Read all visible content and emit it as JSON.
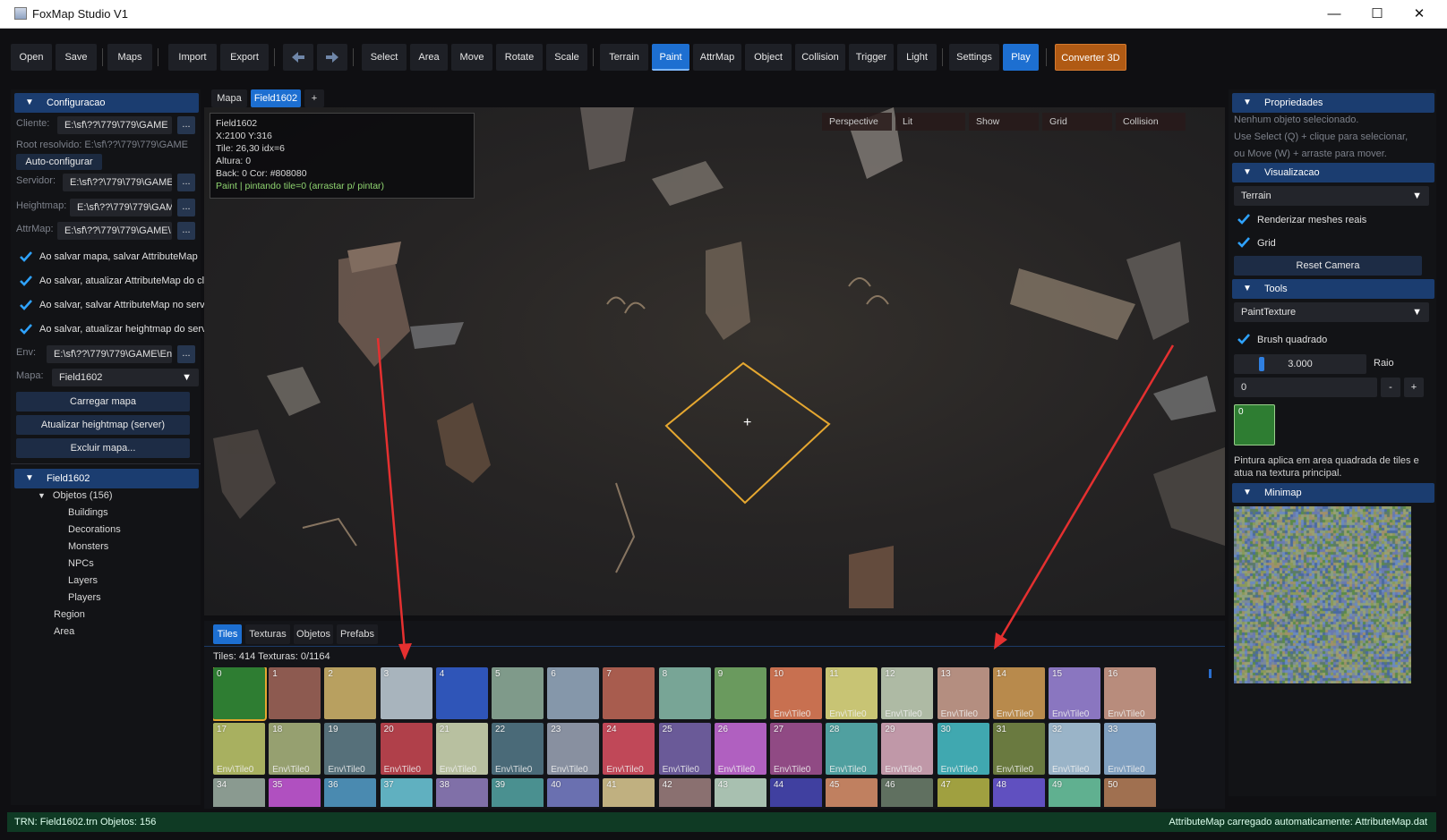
{
  "window": {
    "title": "FoxMap Studio V1",
    "minimize": "—",
    "maximize": "☐",
    "close": "✕"
  },
  "toolbar": {
    "open": "Open",
    "save": "Save",
    "maps": "Maps",
    "import": "Import",
    "export": "Export",
    "back_icon": "arrow-left-icon",
    "forward_icon": "arrow-right-icon",
    "select": "Select",
    "area": "Area",
    "move": "Move",
    "rotate": "Rotate",
    "scale": "Scale",
    "terrain": "Terrain",
    "paint": "Paint",
    "attrmap": "AttrMap",
    "object": "Object",
    "collision": "Collision",
    "trigger": "Trigger",
    "light": "Light",
    "settings": "Settings",
    "play": "Play",
    "converter": "Converter 3D",
    "active_tool": "Paint"
  },
  "config": {
    "header": "Configuracao",
    "cliente_label": "Cliente:",
    "cliente_value": "E:\\sf\\??\\779\\779\\GAME",
    "root_text": "Root resolvido: E:\\sf\\??\\779\\779\\GAME",
    "autoconfig": "Auto-configurar",
    "servidor_label": "Servidor:",
    "servidor_value": "E:\\sf\\??\\779\\779\\GAME",
    "heightmap_label": "Heightmap:",
    "heightmap_value": "E:\\sf\\??\\779\\779\\GAM",
    "attrmap_label": "AttrMap:",
    "attrmap_value": "E:\\sf\\??\\779\\779\\GAME\\",
    "check1": "Ao salvar mapa, salvar AttributeMap",
    "check2": "Ao salvar, atualizar AttributeMap do cl",
    "check3": "Ao salvar, salvar AttributeMap no servi",
    "check4": "Ao salvar, atualizar heightmap do servi",
    "env_label": "Env:",
    "env_value": "E:\\sf\\??\\779\\779\\GAME\\Env",
    "mapa_label": "Mapa:",
    "mapa_value": "Field1602",
    "dots": "...",
    "carregar": "Carregar mapa",
    "atualizar": "Atualizar heightmap (server)",
    "excluir": "Excluir mapa..."
  },
  "tree": {
    "root": "Field1602",
    "objetos": "Objetos (156)",
    "children": [
      "Buildings",
      "Decorations",
      "Monsters",
      "NPCs",
      "Layers",
      "Players"
    ],
    "region": "Region",
    "area": "Area"
  },
  "doc_tabs": [
    "Mapa",
    "Field1602",
    "+"
  ],
  "viewport": {
    "info_lines": [
      "Field1602",
      "X:2100  Y:316",
      "Tile: 26,30   idx=6",
      "Altura: 0",
      "Back: 0    Cor: #808080"
    ],
    "info_status": "Paint | pintando tile=0 (arrastar p/ pintar)",
    "view_buttons": [
      "Perspective",
      "Lit",
      "Show",
      "Grid",
      "Collision"
    ],
    "crosshair": "+"
  },
  "bottom": {
    "tabs": [
      "Tiles",
      "Texturas",
      "Objetos",
      "Prefabs"
    ],
    "counts": "Tiles: 414   Texturas: 0/1164",
    "tile_path": "Env\\Tile0",
    "tiles": [
      {
        "n": "0",
        "c": "#2e7d32"
      },
      {
        "n": "1",
        "c": "#8d5a50"
      },
      {
        "n": "2",
        "c": "#b8a060"
      },
      {
        "n": "3",
        "c": "#a8b4bd"
      },
      {
        "n": "4",
        "c": "#2f55b8"
      },
      {
        "n": "5",
        "c": "#7f9a8a"
      },
      {
        "n": "6",
        "c": "#8597aa"
      },
      {
        "n": "7",
        "c": "#a85c4e"
      },
      {
        "n": "8",
        "c": "#78a596"
      },
      {
        "n": "9",
        "c": "#6a9a5e"
      },
      {
        "n": "10",
        "c": "#c87050"
      },
      {
        "n": "11",
        "c": "#c8c474"
      },
      {
        "n": "12",
        "c": "#aebaa4"
      },
      {
        "n": "13",
        "c": "#b48e80"
      },
      {
        "n": "14",
        "c": "#b88a4c"
      },
      {
        "n": "15",
        "c": "#8a76c0"
      },
      {
        "n": "16",
        "c": "#b88c7c"
      },
      {
        "n": "17",
        "c": "#a8b060"
      },
      {
        "n": "18",
        "c": "#96a070"
      },
      {
        "n": "19",
        "c": "#56707a"
      },
      {
        "n": "20",
        "c": "#b0404a"
      },
      {
        "n": "21",
        "c": "#b8c0a0"
      },
      {
        "n": "22",
        "c": "#4a6a78"
      },
      {
        "n": "23",
        "c": "#8890a0"
      },
      {
        "n": "24",
        "c": "#c04858"
      },
      {
        "n": "25",
        "c": "#6a5a98"
      },
      {
        "n": "26",
        "c": "#b060c0"
      },
      {
        "n": "27",
        "c": "#904a84"
      },
      {
        "n": "28",
        "c": "#50a0a0"
      },
      {
        "n": "29",
        "c": "#c098a8"
      },
      {
        "n": "30",
        "c": "#40a8b0"
      },
      {
        "n": "31",
        "c": "#6a7a40"
      },
      {
        "n": "32",
        "c": "#9ab4c8"
      },
      {
        "n": "33",
        "c": "#80a0c0"
      },
      {
        "n": "34",
        "c": "#8a9a90"
      },
      {
        "n": "35",
        "c": "#b050c0"
      },
      {
        "n": "36",
        "c": "#4a8ab0"
      },
      {
        "n": "37",
        "c": "#60b0c0"
      },
      {
        "n": "38",
        "c": "#8070a8"
      },
      {
        "n": "39",
        "c": "#4a9090"
      },
      {
        "n": "40",
        "c": "#6a70b0"
      },
      {
        "n": "41",
        "c": "#c0b080"
      },
      {
        "n": "42",
        "c": "#8a7070"
      },
      {
        "n": "43",
        "c": "#a8c0b0"
      },
      {
        "n": "44",
        "c": "#4040a0"
      },
      {
        "n": "45",
        "c": "#c08060"
      },
      {
        "n": "46",
        "c": "#607060"
      },
      {
        "n": "47",
        "c": "#a0a040"
      },
      {
        "n": "48",
        "c": "#6050c0"
      },
      {
        "n": "49",
        "c": "#60b090"
      },
      {
        "n": "50",
        "c": "#a07050"
      }
    ]
  },
  "props": {
    "header": "Propriedades",
    "line1": "Nenhum objeto selecionado.",
    "line2": "Use Select (Q) + clique para selecionar,",
    "line3": "ou Move (W) + arraste para mover.",
    "vis_header": "Visualizacao",
    "vis_mode": "Terrain",
    "render_meshes": "Renderizar meshes reais",
    "grid": "Grid",
    "reset_camera": "Reset Camera",
    "tools_header": "Tools",
    "tool_mode": "PaintTexture",
    "brush_quadrado": "Brush quadrado",
    "raio_value": "3.000",
    "raio_label": "Raio",
    "raio_fraction": 0.2,
    "tile_value": "0",
    "minus": "-",
    "plus": "+",
    "swatch_label": "0",
    "swatch_color": "#2e7d32",
    "help_text": "Pintura aplica em area quadrada de tiles e atua na textura principal.",
    "minimap_header": "Minimap"
  },
  "status": {
    "left": "TRN: Field1602.trn   Objetos: 156",
    "right": "AttributeMap carregado automaticamente: AttributeMap.dat"
  }
}
